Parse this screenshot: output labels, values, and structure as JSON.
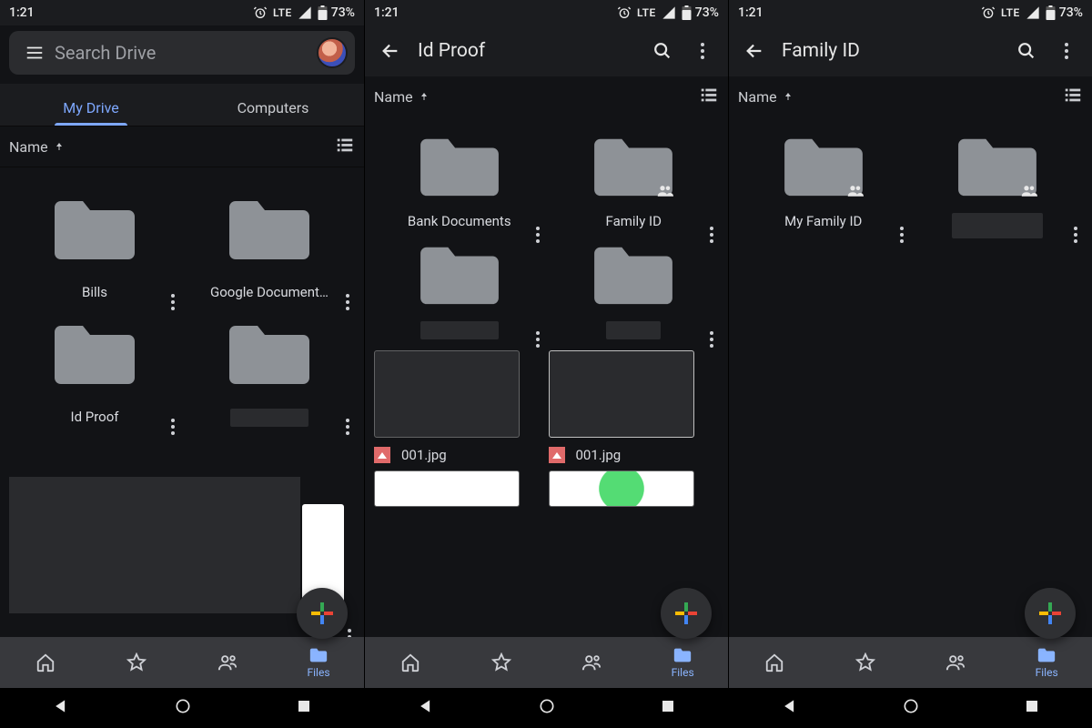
{
  "status": {
    "time": "1:21",
    "network": "LTE",
    "battery": "73%"
  },
  "s1": {
    "search_placeholder": "Search Drive",
    "tabs": {
      "my_drive": "My Drive",
      "computers": "Computers"
    },
    "sort_label": "Name",
    "items": [
      {
        "label": "Bills"
      },
      {
        "label": "Google Document…"
      },
      {
        "label": "Id Proof"
      },
      {
        "label": ""
      }
    ]
  },
  "s2": {
    "title": "Id Proof",
    "sort_label": "Name",
    "folders": [
      {
        "label": "Bank Documents",
        "shared": false
      },
      {
        "label": "Family ID",
        "shared": true
      },
      {
        "label": "",
        "shared": false,
        "redacted": true
      },
      {
        "label": "",
        "shared": false,
        "redacted": true
      }
    ],
    "files": [
      {
        "name": "001.jpg"
      },
      {
        "name": "001.jpg"
      }
    ]
  },
  "s3": {
    "title": "Family ID",
    "sort_label": "Name",
    "folders": [
      {
        "label": "My Family ID",
        "shared": true
      },
      {
        "label": "",
        "shared": true,
        "redacted": true
      }
    ]
  },
  "bottom_nav": {
    "files": "Files"
  }
}
